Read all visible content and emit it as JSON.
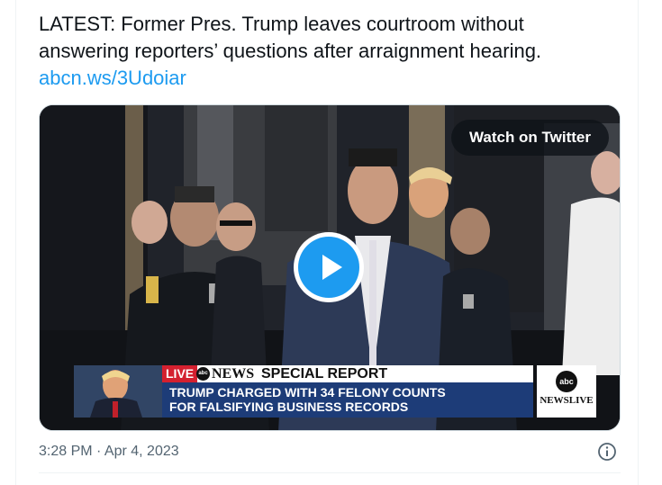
{
  "tweet": {
    "text_line1": "LATEST: Former Pres. Trump leaves courtroom without",
    "text_line2": "answering reporters’ questions after arraignment hearing.",
    "link": "abcn.ws/3Udoiar",
    "timestamp": "3:28 PM · Apr 4, 2023"
  },
  "media": {
    "watch_label": "Watch on Twitter",
    "play_icon": "play-icon",
    "lower_third": {
      "live_label": "LIVE",
      "network_logo": "abc",
      "network_name": "NEWS",
      "banner_label": "SPECIAL REPORT",
      "headline_line1": "TRUMP CHARGED WITH 34 FELONY COUNTS",
      "headline_line2": "FOR FALSIFYING BUSINESS RECORDS",
      "brand_logo": "abc",
      "brand_text": "NEWSLIVE"
    }
  },
  "icons": {
    "info": "info-icon"
  },
  "colors": {
    "link": "#1d9bf0",
    "play": "#1d9bf0",
    "live_red": "#d4202f",
    "banner_blue": "#1d3c78",
    "muted_text": "#536471"
  }
}
